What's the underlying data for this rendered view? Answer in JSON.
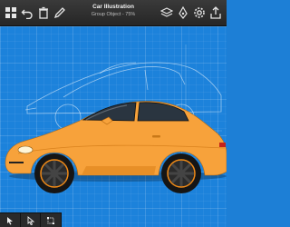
{
  "toolbar": {
    "title": "Car Illustration",
    "subtitle": "Group Object - 75%",
    "left_icons": [
      "grid-icon",
      "undo-icon",
      "trash-icon",
      "pencil-icon"
    ],
    "right_icons": [
      "layers-icon",
      "pen-tool-icon",
      "settings-icon",
      "export-icon"
    ]
  },
  "canvas": {
    "background_color": "#1c82db",
    "car_body_color": "#f7a23b",
    "wheel_rim_accent": "#f08a17"
  },
  "bottom_tools": [
    "select-arrow-icon",
    "node-arrow-icon",
    "transform-icon"
  ]
}
